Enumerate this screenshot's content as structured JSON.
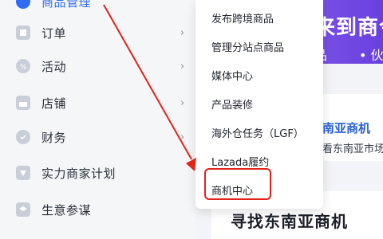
{
  "sidebar": {
    "top_item_label": "商品管理",
    "items": [
      {
        "label": "订单",
        "icon": "order-icon",
        "has_chevron": true
      },
      {
        "label": "活动",
        "icon": "promotion-icon",
        "has_chevron": true
      },
      {
        "label": "店铺",
        "icon": "store-icon",
        "has_chevron": true
      },
      {
        "label": "财务",
        "icon": "finance-icon",
        "has_chevron": true
      },
      {
        "label": "实力商家计划",
        "icon": "merchant-plan-icon",
        "has_chevron": false
      },
      {
        "label": "生意参谋",
        "icon": "business-advisor-icon",
        "has_chevron": false
      }
    ]
  },
  "submenu": {
    "items": [
      {
        "label": "发布跨境商品"
      },
      {
        "label": "管理分站点商品"
      },
      {
        "label": "媒体中心"
      },
      {
        "label": "产品装修"
      },
      {
        "label": "海外仓任务（LGF）"
      },
      {
        "label": "Lazada履约"
      },
      {
        "label": "商机中心"
      }
    ],
    "highlighted": "商机中心"
  },
  "banner": {
    "title": "来到商今",
    "subtitle_left": "品",
    "subtitle_right": "• 伙"
  },
  "card": {
    "title": "南亚商机",
    "subtitle": "看东南亚市场"
  },
  "bottom": {
    "title": "寻找东南亚商机"
  },
  "colors": {
    "accent": "#2f6cf6",
    "annotation_red": "#e2231a",
    "banner_purple": "#7b54e6"
  }
}
